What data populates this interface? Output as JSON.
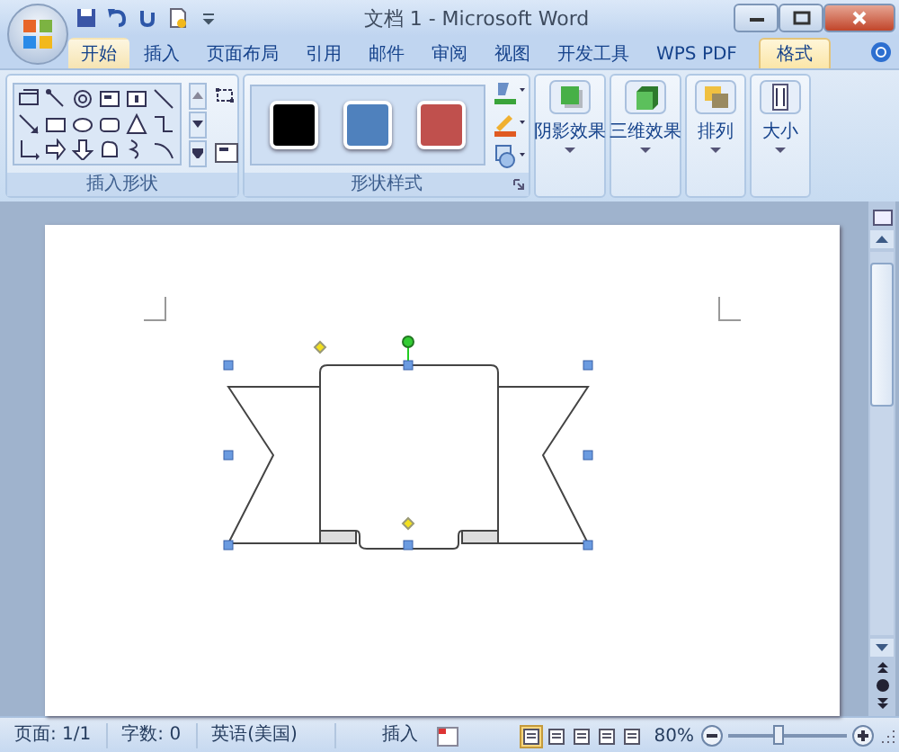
{
  "window": {
    "title": "文档 1 - Microsoft Word"
  },
  "tabs": [
    {
      "label": "开始",
      "selected": false,
      "highlighted": true
    },
    {
      "label": "插入",
      "selected": false,
      "highlighted": false
    },
    {
      "label": "页面布局",
      "selected": false,
      "highlighted": false
    },
    {
      "label": "引用",
      "selected": false,
      "highlighted": false
    },
    {
      "label": "邮件",
      "selected": false,
      "highlighted": false
    },
    {
      "label": "审阅",
      "selected": false,
      "highlighted": false
    },
    {
      "label": "视图",
      "selected": false,
      "highlighted": false
    },
    {
      "label": "开发工具",
      "selected": false,
      "highlighted": false
    },
    {
      "label": "WPS PDF",
      "selected": false,
      "highlighted": false
    },
    {
      "label": "格式",
      "selected": true,
      "highlighted": false
    }
  ],
  "ribbon": {
    "insert_shapes": {
      "label": "插入形状"
    },
    "shape_styles": {
      "label": "形状样式",
      "swatches": [
        {
          "color": "#000000"
        },
        {
          "color": "#4f81bd"
        },
        {
          "color": "#c0504d"
        }
      ]
    },
    "buttons": [
      {
        "label": "阴影效果"
      },
      {
        "label": "三维效果"
      },
      {
        "label": "排列"
      },
      {
        "label": "大小"
      }
    ]
  },
  "status_bar": {
    "page": "页面: 1/1",
    "words": "字数: 0",
    "language": "英语(美国)",
    "mode": "插入",
    "views": [
      {
        "selected": true
      },
      {
        "selected": false
      },
      {
        "selected": false
      },
      {
        "selected": false
      },
      {
        "selected": false
      }
    ],
    "zoom": "80%",
    "zoom_slider": {
      "level": 0.43
    }
  }
}
